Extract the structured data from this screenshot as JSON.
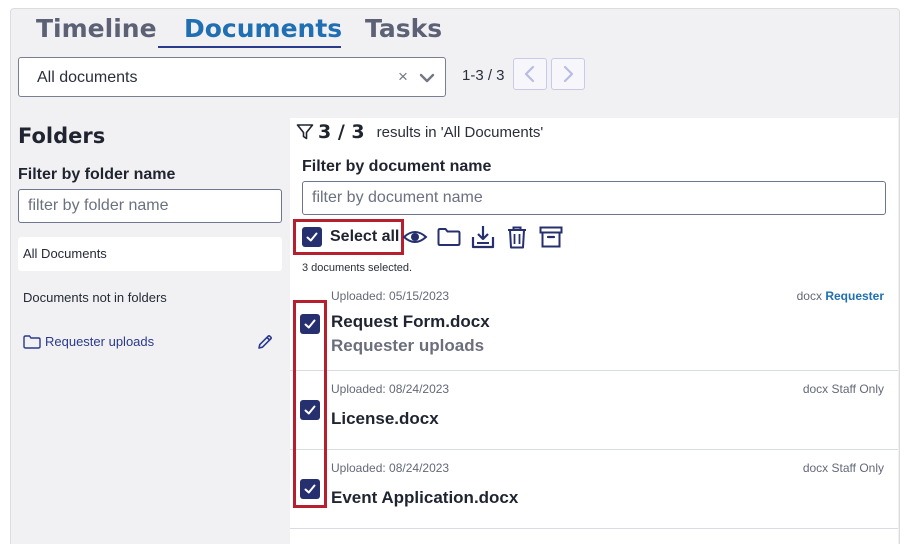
{
  "tabs": [
    {
      "label": "Timeline"
    },
    {
      "label": "Documents"
    },
    {
      "label": "Tasks"
    }
  ],
  "active_tab": "Documents",
  "document_select": {
    "value": "All documents",
    "clear_icon": "×"
  },
  "pager": {
    "text": "1-3 / 3"
  },
  "folders": {
    "title": "Folders",
    "filter_label": "Filter by folder name",
    "filter_placeholder": "filter by folder name",
    "items": [
      {
        "label": "All Documents"
      },
      {
        "label": "Documents not in folders"
      },
      {
        "label": "Requester uploads"
      }
    ]
  },
  "results": {
    "count": "3 / 3",
    "text": "results in 'All Documents'"
  },
  "doc_filter": {
    "label": "Filter by document name",
    "placeholder": "filter by document name"
  },
  "toolbar": {
    "select_all_label": "Select all",
    "icons": [
      "eye-icon",
      "folder-icon",
      "download-icon",
      "trash-icon",
      "archive-icon"
    ]
  },
  "selected_count_text": "3 documents selected.",
  "documents": [
    {
      "uploaded": "Uploaded: 05/15/2023",
      "type": "docx",
      "visibility": "Requester",
      "name": "Request Form.docx",
      "folder": "Requester uploads",
      "checked": true
    },
    {
      "uploaded": "Uploaded: 08/24/2023",
      "type": "docx",
      "visibility": "Staff Only",
      "name": "License.docx",
      "folder": "",
      "checked": true
    },
    {
      "uploaded": "Uploaded: 08/24/2023",
      "type": "docx",
      "visibility": "Staff Only",
      "name": "Event Application.docx",
      "folder": "",
      "checked": true
    }
  ],
  "colors": {
    "accent": "#27306f",
    "active_tab": "#1f6fb2",
    "highlight": "#b51f2e"
  }
}
